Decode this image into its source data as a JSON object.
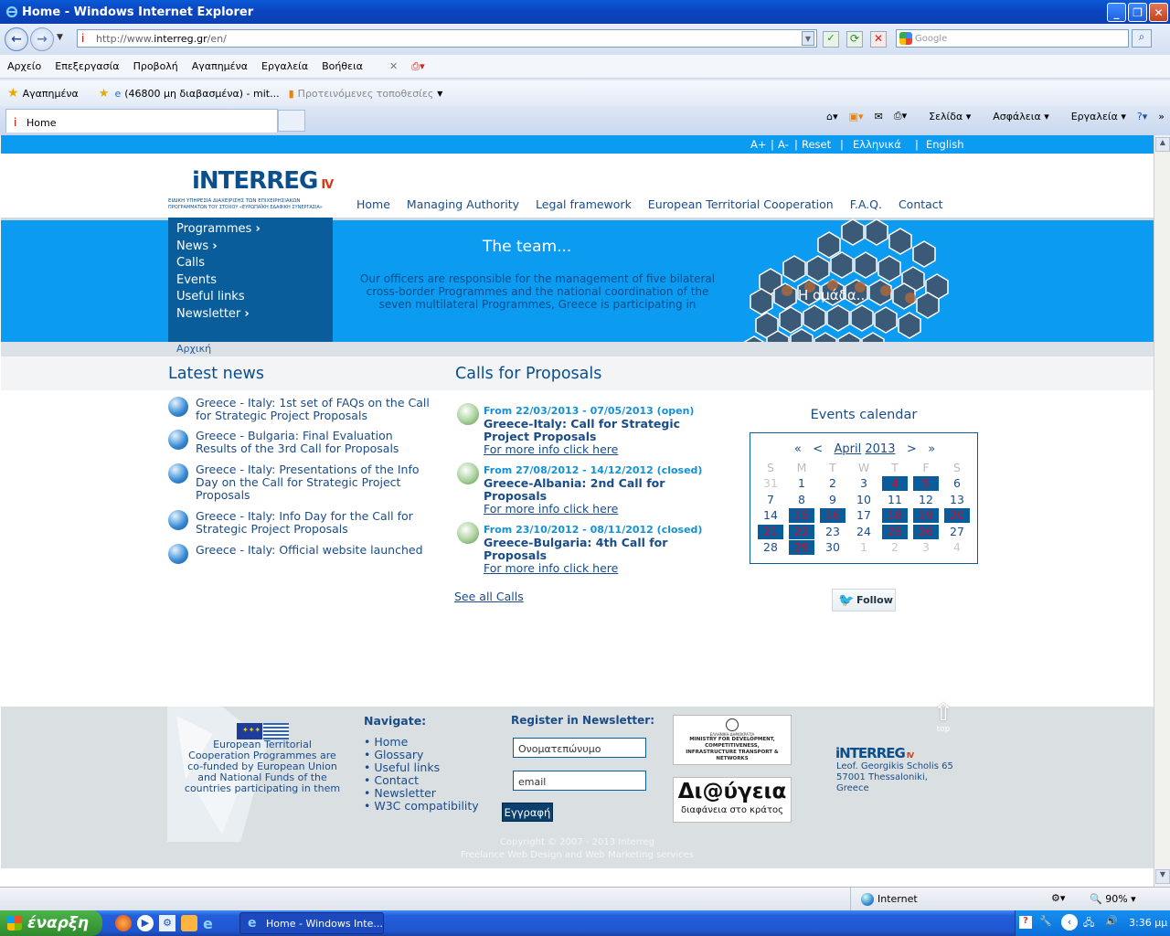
{
  "window": {
    "title": "Home - Windows Internet Explorer"
  },
  "address": {
    "url_prefix": "http://www.",
    "url_domain": "interreg.gr",
    "url_suffix": "/en/",
    "search_placeholder": "Google"
  },
  "menu": [
    "Αρχείο",
    "Επεξεργασία",
    "Προβολή",
    "Αγαπημένα",
    "Εργαλεία",
    "Βοήθεια"
  ],
  "favorites": {
    "label": "Αγαπημένα",
    "item1": "(46800 μη διαβασμένα) - mit...",
    "item2": "Προτεινόμενες τοποθεσίες"
  },
  "tab": {
    "label": "Home"
  },
  "cmdbar": {
    "page": "Σελίδα",
    "safety": "Ασφάλεια",
    "tools": "Εργαλεία"
  },
  "topstrip": {
    "aplus": "A+",
    "aminus": "A-",
    "reset": "Reset",
    "greek": "Ελληνικά",
    "english": "English",
    "sep": "|"
  },
  "logo": {
    "name": "iNTERREG",
    "suffix": "IV",
    "line1": "ΕΙΔΙΚΗ ΥΠΗΡΕΣΙΑ ΔΙΑΧΕΙΡΙΣΗΣ ΤΩΝ ΕΠΙΧΕΙΡΗΣΙΑΚΩΝ",
    "line2": "ΠΡΟΓΡΑΜΜΑΤΩΝ ΤΟΥ ΣΤΟΧΟΥ «ΕΥΡΩΠΑΪΚΗ ΕΔΑΦΙΚΗ ΣΥΝΕΡΓΑΣΙΑ»"
  },
  "mainnav": [
    "Home",
    "Managing Authority",
    "Legal framework",
    "European Territorial Cooperation",
    "F.A.Q.",
    "Contact"
  ],
  "sidenav": [
    {
      "label": "Programmes",
      "arrow": "›"
    },
    {
      "label": "News",
      "arrow": "›"
    },
    {
      "label": "Calls",
      "arrow": ""
    },
    {
      "label": "Events",
      "arrow": ""
    },
    {
      "label": "Useful links",
      "arrow": ""
    },
    {
      "label": "Newsletter",
      "arrow": "›"
    }
  ],
  "hero": {
    "title": "The team...",
    "desc": "Our officers are responsible for the management of five bilateral cross-border Programmes and the national coordination of the seven multilateral Programmes, Greece is participating in",
    "image_caption": "Η ομάδα..."
  },
  "breadcrumb": "Αρχική",
  "news": {
    "title": "Latest news",
    "items": [
      "Greece - Italy: 1st set of FAQs on the Call for Strategic Project Proposals",
      "Greece - Bulgaria: Final Evaluation Results of the 3rd Call for Proposals",
      "Greece - Italy: Presentations of the Info Day on the Call for Strategic Project Proposals",
      "Greece - Italy: Info Day for the Call for Strategic Project Proposals",
      "Greece - Italy: Official website launched"
    ]
  },
  "calls": {
    "title": "Calls for Proposals",
    "items": [
      {
        "date": "From 22/03/2013 - 07/05/2013 (open)",
        "name": "Greece-Italy: Call for Strategic Project Proposals",
        "link": "For more info click here"
      },
      {
        "date": "From 27/08/2012 - 14/12/2012 (closed)",
        "name": "Greece-Albania: 2nd Call for Proposals",
        "link": "For more info click here"
      },
      {
        "date": "From 23/10/2012 - 08/11/2012 (closed)",
        "name": "Greece-Bulgaria: 4th Call for Proposals",
        "link": "For more info click here"
      }
    ],
    "see_all": "See all Calls"
  },
  "calendar": {
    "title": "Events calendar",
    "nav": {
      "first": "«",
      "prev": "<",
      "month": "April",
      "year": "2013",
      "next": ">",
      "last": "»"
    },
    "dow": [
      "S",
      "M",
      "T",
      "W",
      "T",
      "F",
      "S"
    ],
    "weeks": [
      [
        {
          "d": "31",
          "t": "out"
        },
        {
          "d": "1",
          "t": ""
        },
        {
          "d": "2",
          "t": ""
        },
        {
          "d": "3",
          "t": ""
        },
        {
          "d": "4",
          "t": "act"
        },
        {
          "d": "5",
          "t": "act"
        },
        {
          "d": "6",
          "t": ""
        }
      ],
      [
        {
          "d": "7",
          "t": ""
        },
        {
          "d": "8",
          "t": ""
        },
        {
          "d": "9",
          "t": ""
        },
        {
          "d": "10",
          "t": ""
        },
        {
          "d": "11",
          "t": ""
        },
        {
          "d": "12",
          "t": ""
        },
        {
          "d": "13",
          "t": ""
        }
      ],
      [
        {
          "d": "14",
          "t": ""
        },
        {
          "d": "15",
          "t": "act"
        },
        {
          "d": "16",
          "t": "act"
        },
        {
          "d": "17",
          "t": ""
        },
        {
          "d": "18",
          "t": "act"
        },
        {
          "d": "19",
          "t": "act"
        },
        {
          "d": "20",
          "t": "act"
        }
      ],
      [
        {
          "d": "21",
          "t": "act"
        },
        {
          "d": "22",
          "t": "act"
        },
        {
          "d": "23",
          "t": ""
        },
        {
          "d": "24",
          "t": ""
        },
        {
          "d": "25",
          "t": "act"
        },
        {
          "d": "26",
          "t": "act"
        },
        {
          "d": "27",
          "t": ""
        }
      ],
      [
        {
          "d": "28",
          "t": ""
        },
        {
          "d": "29",
          "t": "act"
        },
        {
          "d": "30",
          "t": ""
        },
        {
          "d": "1",
          "t": "out"
        },
        {
          "d": "2",
          "t": "out"
        },
        {
          "d": "3",
          "t": "out"
        },
        {
          "d": "4",
          "t": "out"
        }
      ]
    ]
  },
  "twitter": {
    "label": "Follow"
  },
  "footer": {
    "eu_text": "European Territorial Cooperation Programmes are co-funded by European Union and National Funds of the countries participating in them",
    "navigate_title": "Navigate:",
    "navigate": [
      "Home",
      "Glossary",
      "Useful links",
      "Contact",
      "Newsletter",
      "W3C compatibility"
    ],
    "newsletter_title": "Register in Newsletter:",
    "name_placeholder": "Ονοματεπώνυμο",
    "email_placeholder": "email",
    "register_btn": "Εγγραφή",
    "ministry_top": "ΕΛΛΗΝΙΚΗ ΔΗΜΟΚΡΑΤΙΑ",
    "ministry": "MINISTRY FOR DEVELOPMENT, COMPETITIVENESS, INFRASTRUCTURE TRANSPORT & NETWORKS",
    "diavgeia": "Δι@ύγεια",
    "diavgeia_sub": "διαφάνεια στο κράτος",
    "top": "top",
    "address_logo": "iNTERREG",
    "address_logo_suffix": "IV",
    "address": [
      "Leof. Georgikis Scholis 65",
      "57001 Thessaloniki,",
      "Greece"
    ],
    "copyright": "Copyright © 2007 - 2013 Interreg",
    "credits": "Freelance Web Design and Web Marketing services"
  },
  "status": {
    "zone": "Internet",
    "zoom": "90%"
  },
  "taskbar": {
    "start": "έναρξη",
    "item": "Home - Windows Inte...",
    "lang": "EN",
    "time": "3:36 μμ"
  },
  "colors": {
    "accent": "#0b9bf0",
    "dark": "#0a5d9b",
    "link": "#1a4c8a",
    "event": "#c8102e"
  }
}
